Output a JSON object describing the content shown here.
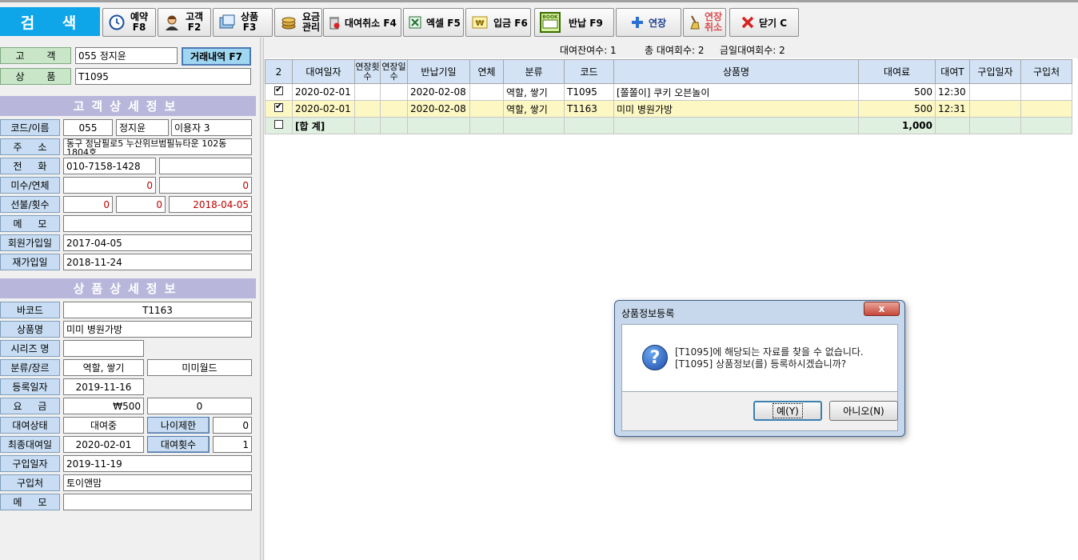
{
  "toolbar": {
    "search_label": "검 색",
    "buttons": [
      {
        "line1": "예약",
        "line2": "F8",
        "icon": "clock-icon"
      },
      {
        "line1": "고객",
        "line2": "F2",
        "icon": "person-icon"
      },
      {
        "line1": "상품",
        "line2": "F3",
        "icon": "product-icon"
      },
      {
        "line1": "요금",
        "line2": "관리",
        "icon": "coins-icon"
      },
      {
        "label": "대여취소 F4",
        "icon": "trash-icon"
      },
      {
        "label": "엑셀 F5",
        "icon": "excel-icon"
      },
      {
        "label": "입금 F6",
        "icon": "won-icon"
      },
      {
        "label": "반납 F9",
        "icon": "book-icon"
      },
      {
        "label": "연장",
        "icon": "plus-icon"
      },
      {
        "line1": "연장",
        "line2": "취소",
        "icon": "broom-icon"
      },
      {
        "label": "닫기 C",
        "icon": "close-x-icon"
      }
    ]
  },
  "search": {
    "customer_label": "고 객",
    "customer_value": "055 정지윤",
    "product_label": "상 품",
    "product_value": "T1095",
    "history_button": "거래내역 F7"
  },
  "customer_detail": {
    "title": "고객상세정보",
    "code_name_label": "코드/이름",
    "code": "055",
    "name": "정지윤",
    "user_type": "이용자 3",
    "address_label": "주 소",
    "address": "동구 정남필로5 누산위브범필뉴타운 102동 1804호",
    "phone_label": "전 화",
    "phone": "010-7158-1428",
    "phone2": "",
    "unpaid_label": "미수/연체",
    "unpaid": "0",
    "overdue": "0",
    "prepaid_label": "선불/횟수",
    "prepaid": "0",
    "prepaid_count": "0",
    "prepaid_date": "2018-04-05",
    "memo_label": "메 모",
    "memo": "",
    "joined_label": "회원가입일",
    "joined": "2017-04-05",
    "rejoined_label": "재가입일",
    "rejoined": "2018-11-24"
  },
  "product_detail": {
    "title": "상품상세정보",
    "barcode_label": "바코드",
    "barcode": "T1163",
    "name_label": "상품명",
    "name": "미미 병원가방",
    "series_label": "시리즈 명",
    "series": "",
    "category_label": "분류/장르",
    "category": "역할, 쌓기",
    "genre": "미미월드",
    "registered_label": "등록일자",
    "registered": "2019-11-16",
    "fee_label": "요 금",
    "fee": "₩500",
    "fee2": "0",
    "status_label": "대여상태",
    "status": "대여중",
    "age_limit_button": "나이제한",
    "age_limit": "0",
    "last_rental_label": "최종대여일",
    "last_rental": "2020-02-01",
    "rental_count_button": "대여횟수",
    "rental_count": "1",
    "purchase_date_label": "구입일자",
    "purchase_date": "2019-11-19",
    "purchaser_label": "구입처",
    "purchaser": "토이앤맘",
    "memo_label": "메 모",
    "memo": ""
  },
  "stats": {
    "remaining": "대여잔여수: 1",
    "total": "총 대여회수: 2",
    "today": "금일대여회수: 2"
  },
  "grid": {
    "columns": [
      "2",
      "대여일자",
      "연장횟수",
      "연장일수",
      "반납기일",
      "연체",
      "분류",
      "코드",
      "상품명",
      "대여료",
      "대여T",
      "구입일자",
      "구입처"
    ],
    "rows": [
      {
        "checked": true,
        "date": "2020-02-01",
        "ext_count": "",
        "ext_days": "",
        "due": "2020-02-08",
        "overdue": "",
        "category": "역할, 쌓기",
        "code": "T1095",
        "name": "[쫄쫄이] 쿠키 오븐놀이",
        "fee": "500",
        "time": "12:30",
        "purchase_date": "",
        "purchaser": ""
      },
      {
        "checked": true,
        "date": "2020-02-01",
        "ext_count": "",
        "ext_days": "",
        "due": "2020-02-08",
        "overdue": "",
        "category": "역할, 쌓기",
        "code": "T1163",
        "name": "미미 병원가방",
        "fee": "500",
        "time": "12:31",
        "purchase_date": "",
        "purchaser": ""
      }
    ],
    "sum_label": "[합 계]",
    "sum_fee": "1,000"
  },
  "dialog": {
    "title": "상품정보등록",
    "line1": "[T1095]에 해당되는 자료를 찾을 수 없습니다.",
    "line2": "[T1095] 상품정보(를) 등록하시겠습니까?",
    "yes": "예(Y)",
    "no": "아니오(N)",
    "close": "x"
  }
}
